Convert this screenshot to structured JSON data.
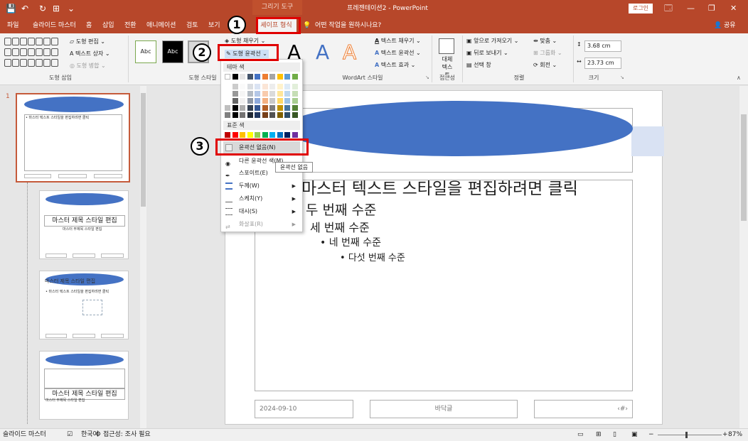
{
  "titlebar": {
    "context_tab": "그리기 도구",
    "title": "프레젠테이션2 - PowerPoint",
    "login": "로그인",
    "quick_access": [
      "💾",
      "↶",
      "↻",
      "⊞",
      "⌄"
    ],
    "window_controls": [
      "🗔",
      "—",
      "❐",
      "✕"
    ]
  },
  "tabs": {
    "items": [
      "파일",
      "슬라이드 마스터",
      "홈",
      "삽입",
      "전환",
      "애니메이션",
      "검토",
      "보기"
    ],
    "active": "셰이프 형식",
    "tell_me": "어떤 작업을 원하시나요?",
    "share": "공유"
  },
  "ribbon": {
    "shape_insert": {
      "label": "도형 삽입",
      "edit_shape": "도형 편집",
      "text_box": "텍스트 상자",
      "merge_shapes": "도형 병합"
    },
    "shape_styles": {
      "label": "도형 스타일",
      "preview1": "Abc",
      "preview2": "Abc",
      "fill": "도형 채우기",
      "outline": "도형 윤곽선"
    },
    "wordart": {
      "label": "WordArt 스타일",
      "letter": "A",
      "text_fill": "텍스트 채우기",
      "text_outline": "텍스트 윤곽선",
      "text_effects": "텍스트 효과"
    },
    "accessibility": {
      "label": "접근성",
      "alt_text": "대체 텍스트"
    },
    "arrange": {
      "label": "정렬",
      "bring_forward": "앞으로 가져오기",
      "send_backward": "뒤로 보내기",
      "selection_pane": "선택 창",
      "align": "맞춤",
      "group": "그룹화",
      "rotate": "회전"
    },
    "size": {
      "label": "크기",
      "height": "3.68 cm",
      "width": "23.73 cm"
    }
  },
  "outline_menu": {
    "theme_colors": "테마 색",
    "standard_colors": "표준 색",
    "no_outline": "윤곽선 없음(N)",
    "more_colors": "다른 윤곽선 색(M)...",
    "eyedropper": "스포이트(E)",
    "weight": "두께(W)",
    "sketch": "스케치(Y)",
    "dashes": "대시(S)",
    "arrows": "화살표(R)",
    "tooltip": "윤곽선 없음",
    "theme_row": [
      "#ffffff",
      "#000000",
      "#e7e6e6",
      "#44546a",
      "#4472c4",
      "#ed7d31",
      "#a5a5a5",
      "#ffc000",
      "#5b9bd5",
      "#70ad47"
    ],
    "standard_row": [
      "#c00000",
      "#ff0000",
      "#ffc000",
      "#ffff00",
      "#92d050",
      "#00b050",
      "#00b0f0",
      "#0070c0",
      "#002060",
      "#7030a0"
    ]
  },
  "annotations": [
    "1",
    "2",
    "3"
  ],
  "slide": {
    "body_lines": [
      "마스터 텍스트 스타일을 편집하려면 클릭",
      "두 번째 수준",
      "세 번째 수준",
      "네 번째 수준",
      "다섯 번째 수준"
    ],
    "date": "2024-09-10",
    "footer": "바닥글",
    "page_number": "‹#›"
  },
  "thumbnails": {
    "slide_number": "1",
    "master_title": "마스터 제목 스타일 편집",
    "body_preview": "• 마스터 텍스트 스타일을 편집하려면 클릭",
    "subtitle_preview": "마스터 부제목 스타일 편집"
  },
  "status": {
    "mode": "슬라이드 마스터",
    "language": "한국어",
    "accessibility": "접근성: 조사 필요",
    "zoom": "87%",
    "zoom_level": 0.87
  }
}
